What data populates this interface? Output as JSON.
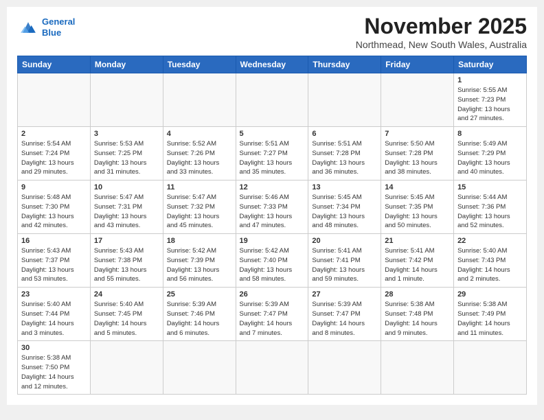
{
  "header": {
    "logo_general": "General",
    "logo_blue": "Blue",
    "month": "November 2025",
    "location": "Northmead, New South Wales, Australia"
  },
  "days_of_week": [
    "Sunday",
    "Monday",
    "Tuesday",
    "Wednesday",
    "Thursday",
    "Friday",
    "Saturday"
  ],
  "weeks": [
    [
      {
        "day": "",
        "empty": true
      },
      {
        "day": "",
        "empty": true
      },
      {
        "day": "",
        "empty": true
      },
      {
        "day": "",
        "empty": true
      },
      {
        "day": "",
        "empty": true
      },
      {
        "day": "",
        "empty": true
      },
      {
        "day": "1",
        "sunrise": "5:55 AM",
        "sunset": "7:23 PM",
        "daylight": "13 hours and 27 minutes."
      }
    ],
    [
      {
        "day": "2",
        "sunrise": "5:54 AM",
        "sunset": "7:24 PM",
        "daylight": "13 hours and 29 minutes."
      },
      {
        "day": "3",
        "sunrise": "5:53 AM",
        "sunset": "7:25 PM",
        "daylight": "13 hours and 31 minutes."
      },
      {
        "day": "4",
        "sunrise": "5:52 AM",
        "sunset": "7:26 PM",
        "daylight": "13 hours and 33 minutes."
      },
      {
        "day": "5",
        "sunrise": "5:51 AM",
        "sunset": "7:27 PM",
        "daylight": "13 hours and 35 minutes."
      },
      {
        "day": "6",
        "sunrise": "5:51 AM",
        "sunset": "7:28 PM",
        "daylight": "13 hours and 36 minutes."
      },
      {
        "day": "7",
        "sunrise": "5:50 AM",
        "sunset": "7:28 PM",
        "daylight": "13 hours and 38 minutes."
      },
      {
        "day": "8",
        "sunrise": "5:49 AM",
        "sunset": "7:29 PM",
        "daylight": "13 hours and 40 minutes."
      }
    ],
    [
      {
        "day": "9",
        "sunrise": "5:48 AM",
        "sunset": "7:30 PM",
        "daylight": "13 hours and 42 minutes."
      },
      {
        "day": "10",
        "sunrise": "5:47 AM",
        "sunset": "7:31 PM",
        "daylight": "13 hours and 43 minutes."
      },
      {
        "day": "11",
        "sunrise": "5:47 AM",
        "sunset": "7:32 PM",
        "daylight": "13 hours and 45 minutes."
      },
      {
        "day": "12",
        "sunrise": "5:46 AM",
        "sunset": "7:33 PM",
        "daylight": "13 hours and 47 minutes."
      },
      {
        "day": "13",
        "sunrise": "5:45 AM",
        "sunset": "7:34 PM",
        "daylight": "13 hours and 48 minutes."
      },
      {
        "day": "14",
        "sunrise": "5:45 AM",
        "sunset": "7:35 PM",
        "daylight": "13 hours and 50 minutes."
      },
      {
        "day": "15",
        "sunrise": "5:44 AM",
        "sunset": "7:36 PM",
        "daylight": "13 hours and 52 minutes."
      }
    ],
    [
      {
        "day": "16",
        "sunrise": "5:43 AM",
        "sunset": "7:37 PM",
        "daylight": "13 hours and 53 minutes."
      },
      {
        "day": "17",
        "sunrise": "5:43 AM",
        "sunset": "7:38 PM",
        "daylight": "13 hours and 55 minutes."
      },
      {
        "day": "18",
        "sunrise": "5:42 AM",
        "sunset": "7:39 PM",
        "daylight": "13 hours and 56 minutes."
      },
      {
        "day": "19",
        "sunrise": "5:42 AM",
        "sunset": "7:40 PM",
        "daylight": "13 hours and 58 minutes."
      },
      {
        "day": "20",
        "sunrise": "5:41 AM",
        "sunset": "7:41 PM",
        "daylight": "13 hours and 59 minutes."
      },
      {
        "day": "21",
        "sunrise": "5:41 AM",
        "sunset": "7:42 PM",
        "daylight": "14 hours and 1 minute."
      },
      {
        "day": "22",
        "sunrise": "5:40 AM",
        "sunset": "7:43 PM",
        "daylight": "14 hours and 2 minutes."
      }
    ],
    [
      {
        "day": "23",
        "sunrise": "5:40 AM",
        "sunset": "7:44 PM",
        "daylight": "14 hours and 3 minutes."
      },
      {
        "day": "24",
        "sunrise": "5:40 AM",
        "sunset": "7:45 PM",
        "daylight": "14 hours and 5 minutes."
      },
      {
        "day": "25",
        "sunrise": "5:39 AM",
        "sunset": "7:46 PM",
        "daylight": "14 hours and 6 minutes."
      },
      {
        "day": "26",
        "sunrise": "5:39 AM",
        "sunset": "7:47 PM",
        "daylight": "14 hours and 7 minutes."
      },
      {
        "day": "27",
        "sunrise": "5:39 AM",
        "sunset": "7:47 PM",
        "daylight": "14 hours and 8 minutes."
      },
      {
        "day": "28",
        "sunrise": "5:38 AM",
        "sunset": "7:48 PM",
        "daylight": "14 hours and 9 minutes."
      },
      {
        "day": "29",
        "sunrise": "5:38 AM",
        "sunset": "7:49 PM",
        "daylight": "14 hours and 11 minutes."
      }
    ],
    [
      {
        "day": "30",
        "sunrise": "5:38 AM",
        "sunset": "7:50 PM",
        "daylight": "14 hours and 12 minutes."
      },
      {
        "day": "",
        "empty": true
      },
      {
        "day": "",
        "empty": true
      },
      {
        "day": "",
        "empty": true
      },
      {
        "day": "",
        "empty": true
      },
      {
        "day": "",
        "empty": true
      },
      {
        "day": "",
        "empty": true
      }
    ]
  ]
}
